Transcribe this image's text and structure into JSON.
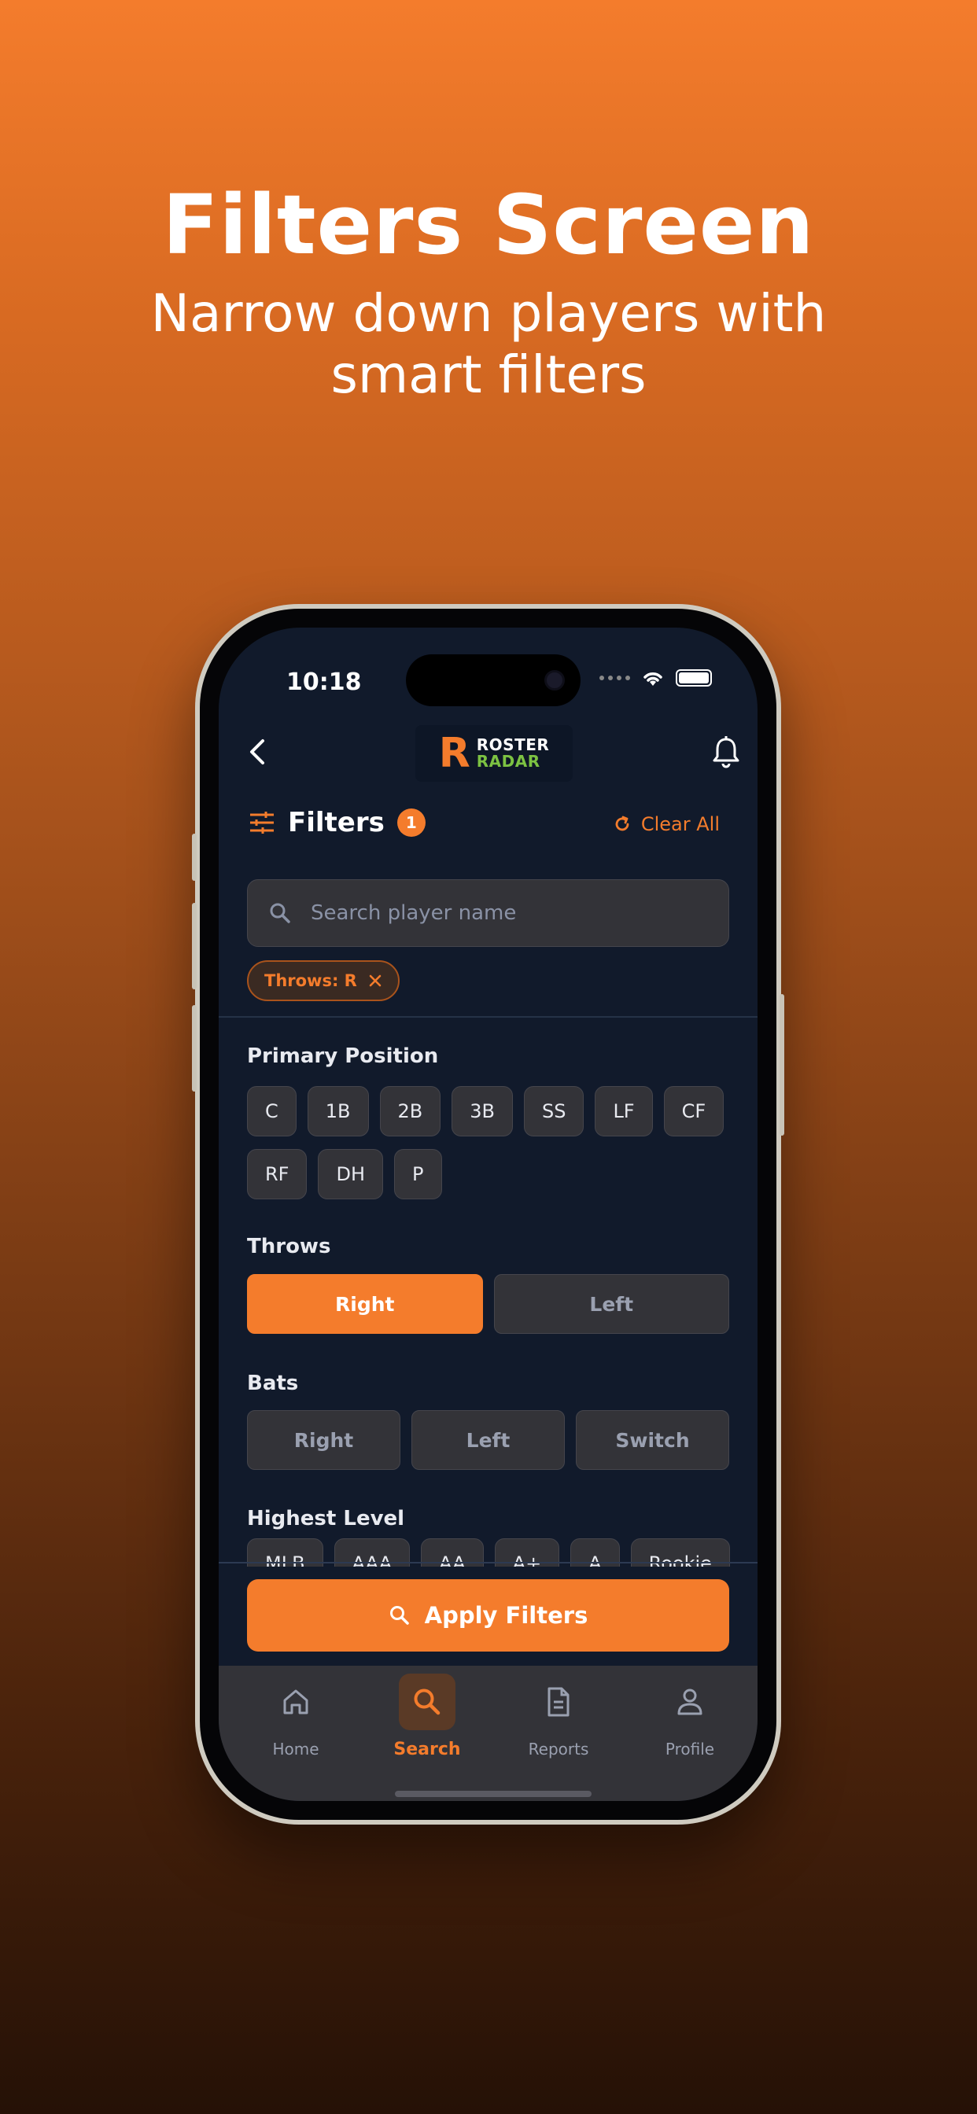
{
  "promo": {
    "title": "Filters Screen",
    "subtitle": "Narrow down players with smart filters"
  },
  "status_bar": {
    "time": "10:18"
  },
  "header": {
    "logo_line1": "ROSTER",
    "logo_line2": "RADAR",
    "logo_mark": "R"
  },
  "filters": {
    "title": "Filters",
    "active_count": "1",
    "clear_all_label": "Clear All"
  },
  "search": {
    "placeholder": "Search player name"
  },
  "active_chips": [
    {
      "label": "Throws: R"
    }
  ],
  "sections": {
    "primary_position": {
      "label": "Primary Position",
      "options": [
        "C",
        "1B",
        "2B",
        "3B",
        "SS",
        "LF",
        "CF",
        "RF",
        "DH",
        "P"
      ]
    },
    "throws": {
      "label": "Throws",
      "options": [
        "Right",
        "Left"
      ],
      "selected": "Right"
    },
    "bats": {
      "label": "Bats",
      "options": [
        "Right",
        "Left",
        "Switch"
      ]
    },
    "highest_level": {
      "label": "Highest Level",
      "options": [
        "MLB",
        "AAA",
        "AA",
        "A+",
        "A",
        "Rookie"
      ]
    }
  },
  "apply_button": {
    "label": "Apply Filters"
  },
  "tabbar": {
    "items": [
      {
        "label": "Home",
        "icon": "home-icon"
      },
      {
        "label": "Search",
        "icon": "search-icon",
        "active": true
      },
      {
        "label": "Reports",
        "icon": "document-icon"
      },
      {
        "label": "Profile",
        "icon": "person-icon"
      }
    ]
  },
  "colors": {
    "accent": "#f47c2c",
    "screen_bg": "#111a2b",
    "chip_bg": "#333338",
    "logo_green": "#7cc242"
  }
}
